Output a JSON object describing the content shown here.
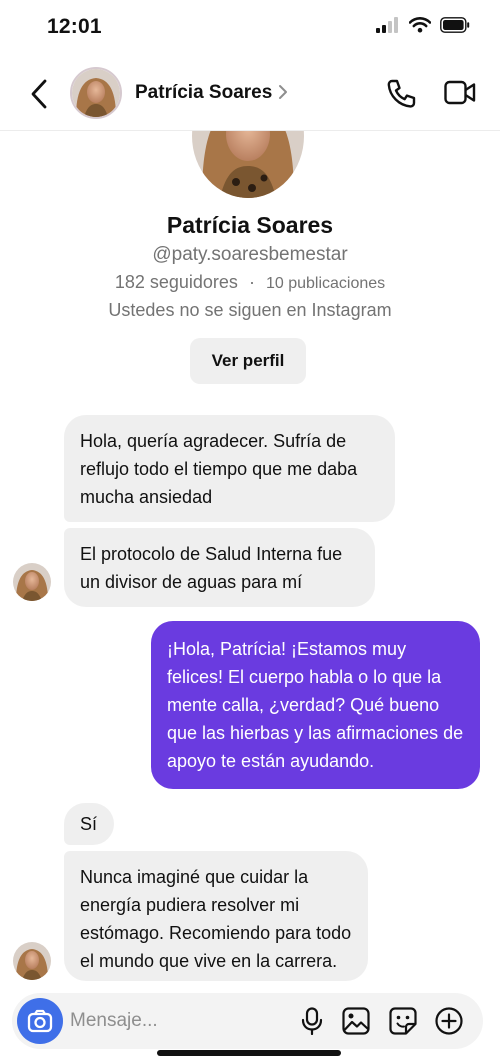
{
  "status_bar": {
    "time": "12:01"
  },
  "header": {
    "contact_name": "Patrícia Soares"
  },
  "profile": {
    "name": "Patrícia Soares",
    "handle": "@paty.soaresbemestar",
    "followers": "182 seguidores",
    "separator": "·",
    "posts": "10 publicaciones",
    "follow_status": "Ustedes no se siguen en Instagram",
    "view_profile_label": "Ver perfil"
  },
  "messages": [
    {
      "from": "contact",
      "text": "Hola, quería agradecer. Sufría de reflujo todo el tiempo que me daba mucha ansiedad"
    },
    {
      "from": "contact",
      "text": "El protocolo de Salud Interna fue un divisor de aguas para mí"
    },
    {
      "from": "me",
      "text": "¡Hola, Patrícia! ¡Estamos muy felices! El cuerpo habla o lo que la mente calla, ¿verdad? Qué bueno que las hierbas y las afirmaciones de apoyo te están ayudando."
    },
    {
      "from": "contact",
      "text": "Sí"
    },
    {
      "from": "contact",
      "text": "Nunca imaginé que cuidar la energía pudiera resolver mi estómago. Recomiendo para todo el mundo que vive en la carrera."
    }
  ],
  "composer": {
    "placeholder": "Mensaje..."
  },
  "colors": {
    "outgoing_bubble": "#6a3be0",
    "incoming_bubble": "#efefef",
    "camera_button": "#3f6fe8"
  }
}
